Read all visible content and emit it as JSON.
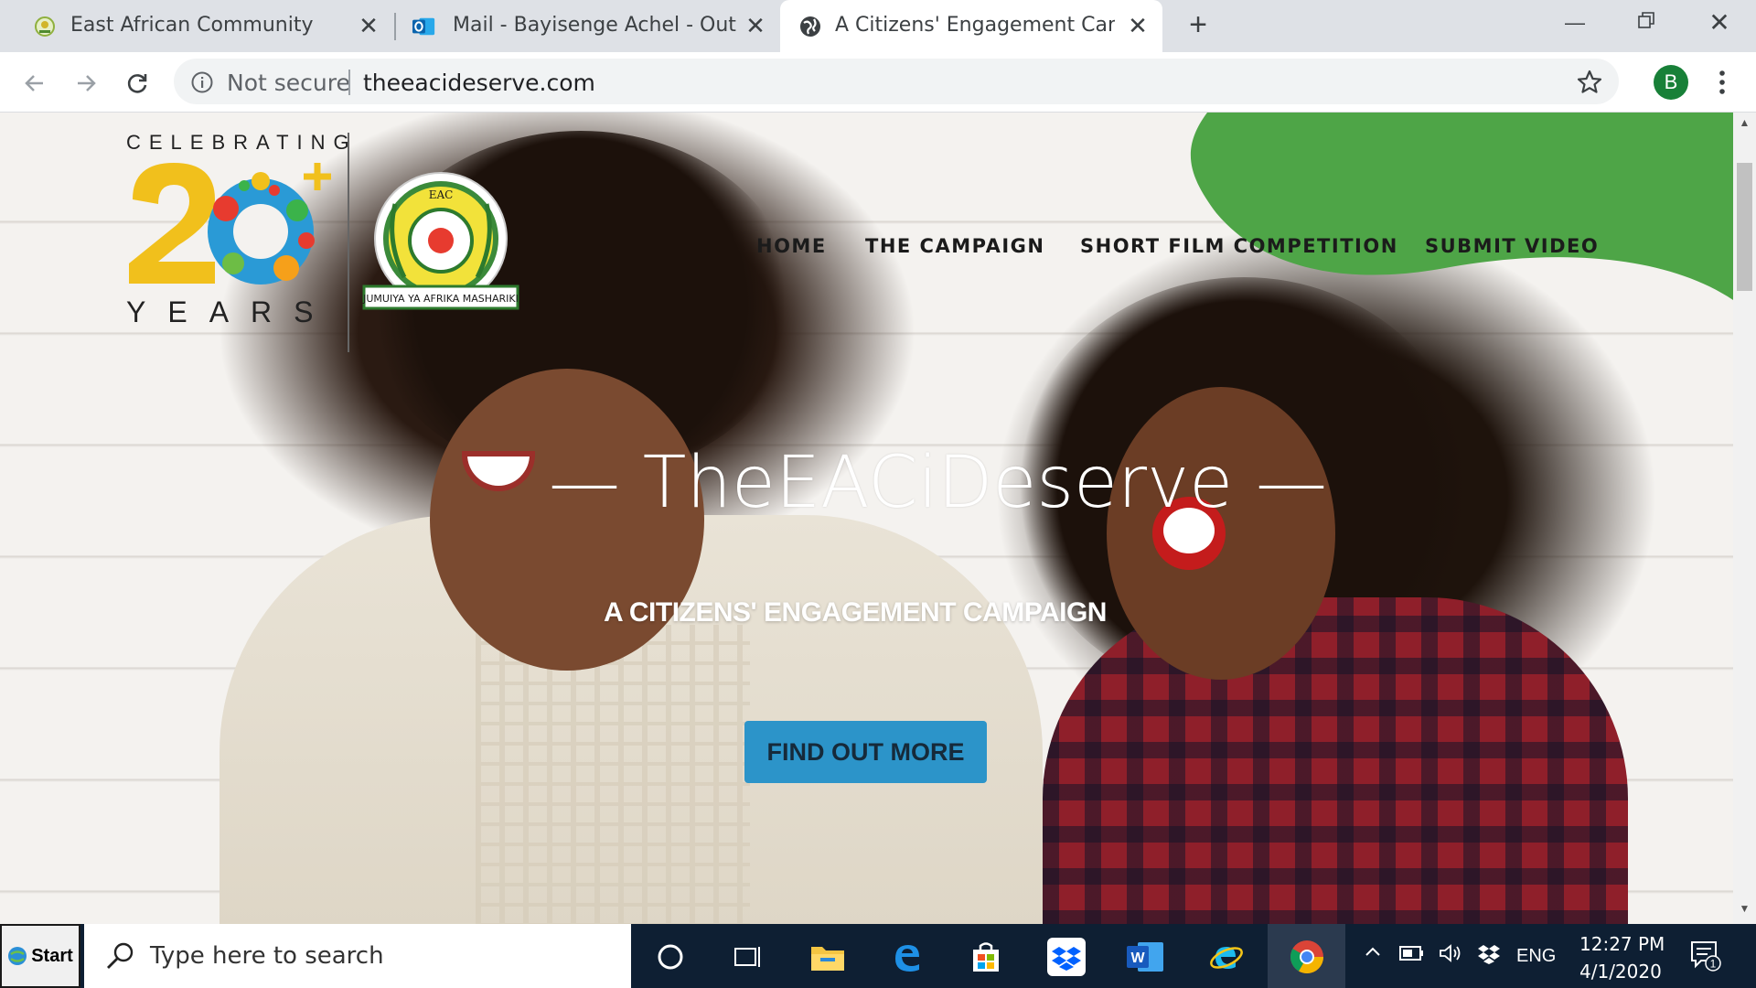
{
  "browser": {
    "tabs": [
      {
        "title": "East African Community",
        "icon": "eac-favicon"
      },
      {
        "title": "Mail - Bayisenge Achel - Outlook",
        "icon": "outlook-icon"
      },
      {
        "title": "A Citizens' Engagement Campaig",
        "icon": "globe-icon",
        "active": true
      }
    ],
    "new_tab_label": "+",
    "not_secure_label": "Not secure",
    "url": "theeacideserve.com",
    "profile_initial": "B"
  },
  "page": {
    "logo": {
      "celebrating": "CELEBRATING",
      "years": "YEARS",
      "seal_top_text": "EAC",
      "seal_banner": "JUMUIYA YA AFRIKA MASHARIKI"
    },
    "nav": [
      {
        "label": "HOME"
      },
      {
        "label": "THE CAMPAIGN"
      },
      {
        "label": "SHORT FILM COMPETITION"
      },
      {
        "label": "SUBMIT VIDEO"
      }
    ],
    "hero_title": "— TheEACiDeserve —",
    "hero_subtitle": "A CITIZENS' ENGAGEMENT CAMPAIGN",
    "cta_label": "FIND OUT MORE",
    "colors": {
      "accent_green": "#4ea547",
      "cta_blue": "#2c94c9"
    }
  },
  "taskbar": {
    "start_label": "Start",
    "search_placeholder": "Type here to search",
    "tray_language": "ENG",
    "time": "12:27 PM",
    "date": "4/1/2020",
    "notification_count": "1"
  }
}
